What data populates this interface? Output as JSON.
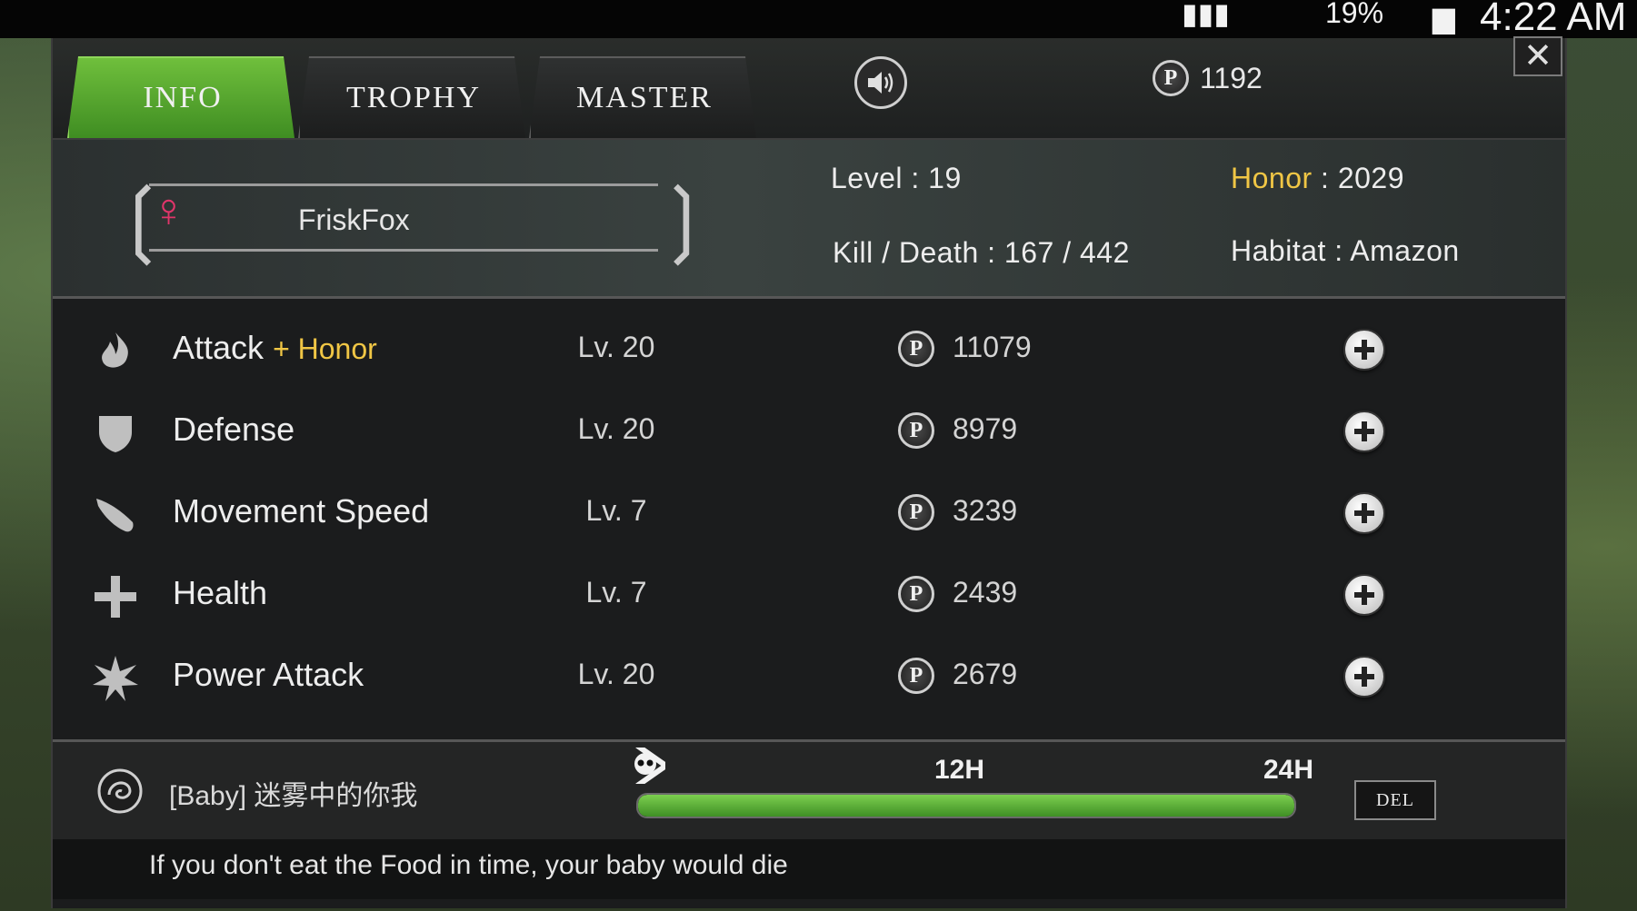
{
  "status_bar": {
    "battery": "19%",
    "time": "4:22 AM"
  },
  "tabs": [
    {
      "label": "INFO",
      "active": true
    },
    {
      "label": "TROPHY",
      "active": false
    },
    {
      "label": "MASTER",
      "active": false
    }
  ],
  "points": {
    "coin_symbol": "P",
    "value": "1192"
  },
  "close_symbol": "✕",
  "profile": {
    "name": "FriskFox",
    "gender_icon": "female-icon",
    "level_label": "Level",
    "level_value": "19",
    "honor_label": "Honor",
    "honor_value": "2029",
    "kd_label": "Kill / Death",
    "kd_value": "167 / 442",
    "habitat_label": "Habitat",
    "habitat_value": "Amazon"
  },
  "stats": [
    {
      "name": "Attack",
      "extra": "+ Honor",
      "level": "Lv. 20",
      "cost": "11079",
      "icon": "flame-icon"
    },
    {
      "name": "Defense",
      "extra": "",
      "level": "Lv. 20",
      "cost": "8979",
      "icon": "shield-icon"
    },
    {
      "name": "Movement Speed",
      "extra": "",
      "level": "Lv. 7",
      "cost": "3239",
      "icon": "wing-icon"
    },
    {
      "name": "Health",
      "extra": "",
      "level": "Lv. 7",
      "cost": "2439",
      "icon": "cross-icon"
    },
    {
      "name": "Power Attack",
      "extra": "",
      "level": "Lv. 20",
      "cost": "2679",
      "icon": "burst-icon"
    }
  ],
  "baby": {
    "name": "[Baby]  迷雾中的你我",
    "mark_12": "12H",
    "mark_24": "24H",
    "timer_fraction": 1.0,
    "del_label": "DEL",
    "notice": "If you don't eat the Food in time, your baby would die"
  },
  "colors": {
    "accent_green": "#4fa52c",
    "honor_gold": "#f0c645",
    "female_pink": "#e0356a"
  }
}
